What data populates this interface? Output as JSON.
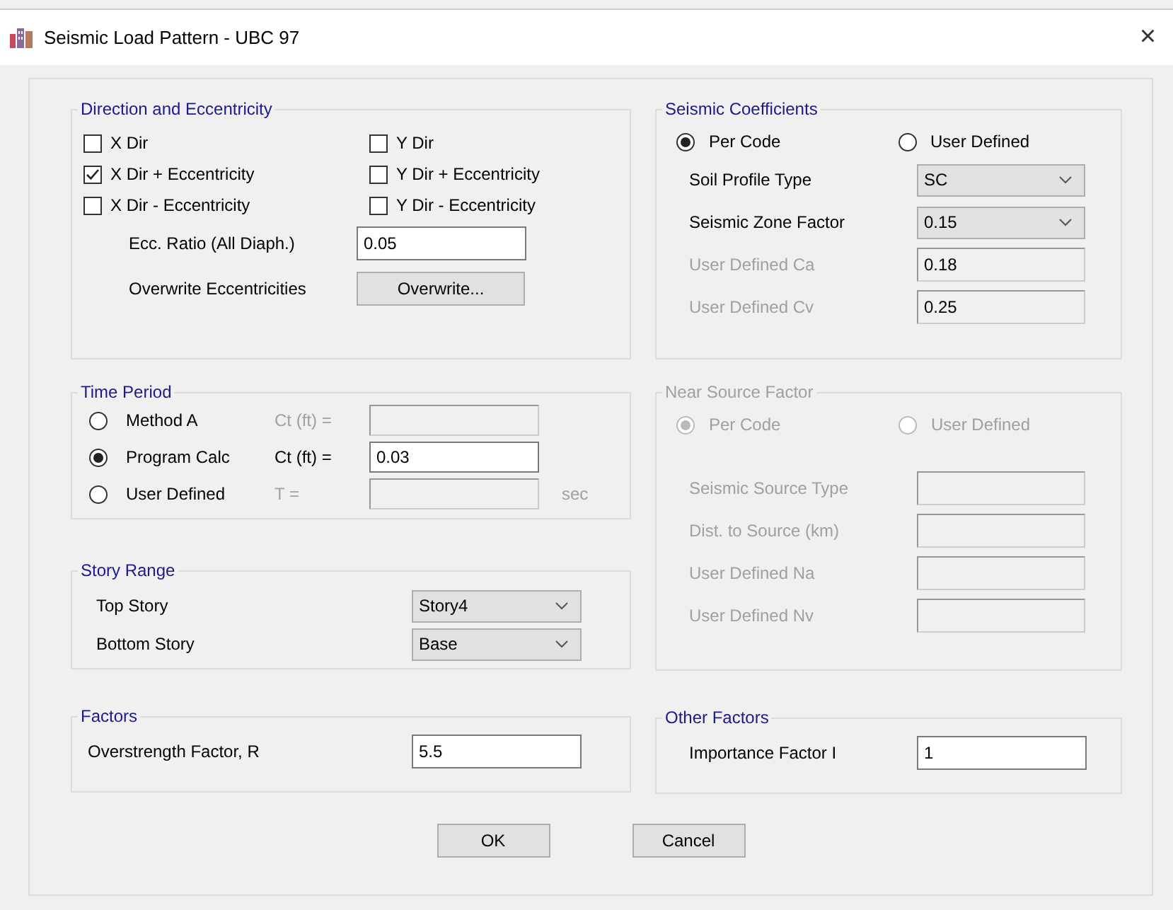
{
  "window": {
    "title": "Seismic Load Pattern - UBC 97",
    "close": "×"
  },
  "direction_and_eccentricity": {
    "title": "Direction and Eccentricity",
    "checkboxes": [
      {
        "label": "X Dir",
        "checked": false
      },
      {
        "label": "Y Dir",
        "checked": false
      },
      {
        "label": "X Dir + Eccentricity",
        "checked": true
      },
      {
        "label": "Y Dir + Eccentricity",
        "checked": false
      },
      {
        "label": "X Dir - Eccentricity",
        "checked": false
      },
      {
        "label": "Y Dir - Eccentricity",
        "checked": false
      }
    ],
    "ecc_ratio": {
      "label": "Ecc. Ratio (All Diaph.)",
      "value": "0.05"
    },
    "overwrite": {
      "label": "Overwrite Eccentricities",
      "button": "Overwrite..."
    }
  },
  "time_period": {
    "title": "Time Period",
    "options": [
      {
        "label": "Method A",
        "selected": false,
        "param_label": "Ct (ft) =",
        "disabled": true
      },
      {
        "label": "Program Calc",
        "selected": true,
        "param_label": "Ct (ft) =",
        "value": "0.03",
        "disabled": false
      },
      {
        "label": "User Defined",
        "selected": false,
        "param_label": "T =",
        "unit": "sec",
        "disabled": true
      }
    ]
  },
  "story_range": {
    "title": "Story Range",
    "rows": [
      {
        "label": "Top Story",
        "kind": "select",
        "value": "Story4",
        "disabled": false
      },
      {
        "label": "Bottom Story",
        "kind": "select",
        "value": "Base",
        "disabled": false
      }
    ]
  },
  "factors": {
    "title": "Factors",
    "rows": [
      {
        "label": "Overstrength Factor, R",
        "kind": "input",
        "value": "5.5",
        "disabled": false
      }
    ]
  },
  "seismic_coefficients": {
    "title": "Seismic Coefficients",
    "disabled": false,
    "radios": [
      {
        "label": "Per Code",
        "selected": true
      },
      {
        "label": "User Defined",
        "selected": false
      }
    ],
    "rows": [
      {
        "label": "Soil Profile Type",
        "kind": "select",
        "value": "SC",
        "disabled": false
      },
      {
        "label": "Seismic Zone Factor",
        "kind": "select",
        "value": "0.15",
        "disabled": false
      },
      {
        "label": "User Defined  Ca",
        "kind": "input",
        "value": "0.18",
        "disabled": true
      },
      {
        "label": "User Defined  Cv",
        "kind": "input",
        "value": "0.25",
        "disabled": true
      }
    ]
  },
  "near_source_factor": {
    "title": "Near Source Factor",
    "disabled": true,
    "radios": [
      {
        "label": "Per Code",
        "selected": true
      },
      {
        "label": "User Defined",
        "selected": false
      }
    ],
    "rows": [
      {
        "label": "Seismic Source Type",
        "kind": "input",
        "disabled": true
      },
      {
        "label": "Dist. to Source (km)",
        "kind": "input",
        "disabled": true
      },
      {
        "label": "User Defined  Na",
        "kind": "input",
        "disabled": true
      },
      {
        "label": "User Defined  Nv",
        "kind": "input",
        "disabled": true
      }
    ]
  },
  "other_factors": {
    "title": "Other Factors",
    "rows": [
      {
        "label": "Importance Factor  I",
        "kind": "input",
        "value": "1",
        "disabled": false
      }
    ]
  },
  "buttons": [
    "OK",
    "Cancel"
  ]
}
